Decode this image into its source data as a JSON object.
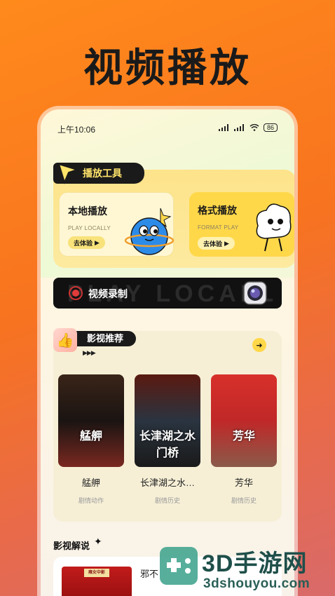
{
  "promo": {
    "title": "视频播放"
  },
  "status_bar": {
    "time": "上午10:06",
    "battery": "86"
  },
  "tools": {
    "section_label": "播放工具",
    "cards": [
      {
        "title": "本地播放",
        "subtitle": "PLAY LOCALLY",
        "button": "去体验"
      },
      {
        "title": "格式播放",
        "subtitle": "FORMAT PLAY",
        "button": "去体验"
      }
    ]
  },
  "record": {
    "watermark": "PLAY LOCALL",
    "label": "视频录制"
  },
  "recommend": {
    "section_label": "影视推荐",
    "movies": [
      {
        "poster_text": "艋舺",
        "name": "艋舺",
        "genre": "剧情动作",
        "colors": [
          "#3a2418",
          "#1a1412",
          "#7a2820"
        ]
      },
      {
        "poster_text": "长津湖之水门桥",
        "name": "长津湖之水…",
        "genre": "剧情历史",
        "colors": [
          "#5a1a10",
          "#2a3440",
          "#1a1a1a"
        ]
      },
      {
        "poster_text": "芳华",
        "name": "芳华",
        "genre": "剧情历史",
        "colors": [
          "#d8302a",
          "#c02828",
          "#8a5a4a"
        ]
      }
    ]
  },
  "commentary": {
    "section_label": "影视解说",
    "thumb_label": "雍女中影",
    "item_title": "邪不"
  },
  "watermark": {
    "main": "3D手游网",
    "sub": "3dshouyou.com"
  }
}
